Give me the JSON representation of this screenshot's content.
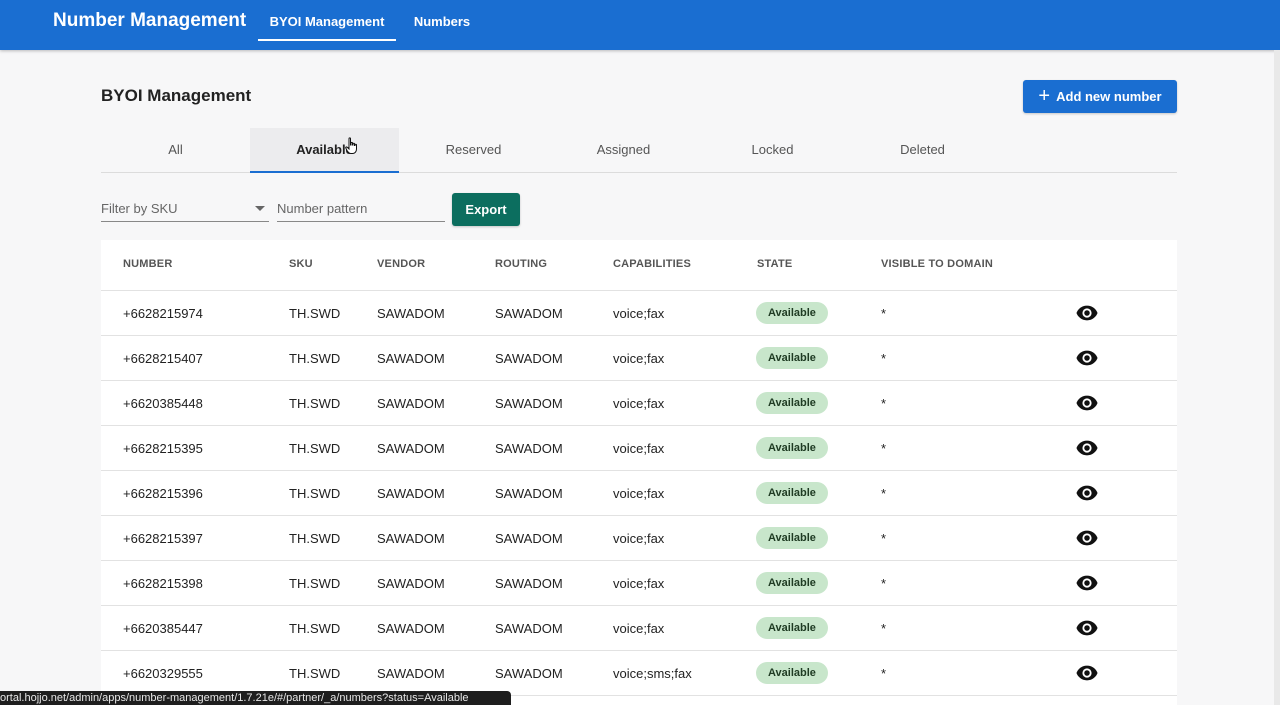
{
  "header": {
    "app_title": "Number Management",
    "nav": [
      {
        "label": "BYOI Management",
        "active": true
      },
      {
        "label": "Numbers",
        "active": false
      }
    ]
  },
  "page": {
    "title": "BYOI Management",
    "add_button_label": "Add new number"
  },
  "tabs": [
    {
      "label": "All",
      "active": false
    },
    {
      "label": "Available",
      "active": true
    },
    {
      "label": "Reserved",
      "active": false
    },
    {
      "label": "Assigned",
      "active": false
    },
    {
      "label": "Locked",
      "active": false
    },
    {
      "label": "Deleted",
      "active": false
    }
  ],
  "filters": {
    "sku_placeholder": "Filter by SKU",
    "pattern_placeholder": "Number pattern",
    "export_label": "Export"
  },
  "table": {
    "columns": [
      "NUMBER",
      "SKU",
      "VENDOR",
      "ROUTING",
      "CAPABILITIES",
      "STATE",
      "VISIBLE TO DOMAIN"
    ],
    "rows": [
      {
        "number": "+6628215974",
        "sku": "TH.SWD",
        "vendor": "SAWADOM",
        "routing": "SAWADOM",
        "capabilities": "voice;fax",
        "state": "Available",
        "domain": "*"
      },
      {
        "number": "+6628215407",
        "sku": "TH.SWD",
        "vendor": "SAWADOM",
        "routing": "SAWADOM",
        "capabilities": "voice;fax",
        "state": "Available",
        "domain": "*"
      },
      {
        "number": "+6620385448",
        "sku": "TH.SWD",
        "vendor": "SAWADOM",
        "routing": "SAWADOM",
        "capabilities": "voice;fax",
        "state": "Available",
        "domain": "*"
      },
      {
        "number": "+6628215395",
        "sku": "TH.SWD",
        "vendor": "SAWADOM",
        "routing": "SAWADOM",
        "capabilities": "voice;fax",
        "state": "Available",
        "domain": "*"
      },
      {
        "number": "+6628215396",
        "sku": "TH.SWD",
        "vendor": "SAWADOM",
        "routing": "SAWADOM",
        "capabilities": "voice;fax",
        "state": "Available",
        "domain": "*"
      },
      {
        "number": "+6628215397",
        "sku": "TH.SWD",
        "vendor": "SAWADOM",
        "routing": "SAWADOM",
        "capabilities": "voice;fax",
        "state": "Available",
        "domain": "*"
      },
      {
        "number": "+6628215398",
        "sku": "TH.SWD",
        "vendor": "SAWADOM",
        "routing": "SAWADOM",
        "capabilities": "voice;fax",
        "state": "Available",
        "domain": "*"
      },
      {
        "number": "+6620385447",
        "sku": "TH.SWD",
        "vendor": "SAWADOM",
        "routing": "SAWADOM",
        "capabilities": "voice;fax",
        "state": "Available",
        "domain": "*"
      },
      {
        "number": "+6620329555",
        "sku": "TH.SWD",
        "vendor": "SAWADOM",
        "routing": "SAWADOM",
        "capabilities": "voice;sms;fax",
        "state": "Available",
        "domain": "*"
      }
    ]
  },
  "status_bar_url": "ortal.hojjo.net/admin/apps/number-management/1.7.21e/#/partner/_a/numbers?status=Available",
  "colors": {
    "header": "#1a6ed1",
    "primary_button": "#1a6ed1",
    "export_button": "#0c6e5f",
    "available_badge": "#c8e6cb"
  }
}
